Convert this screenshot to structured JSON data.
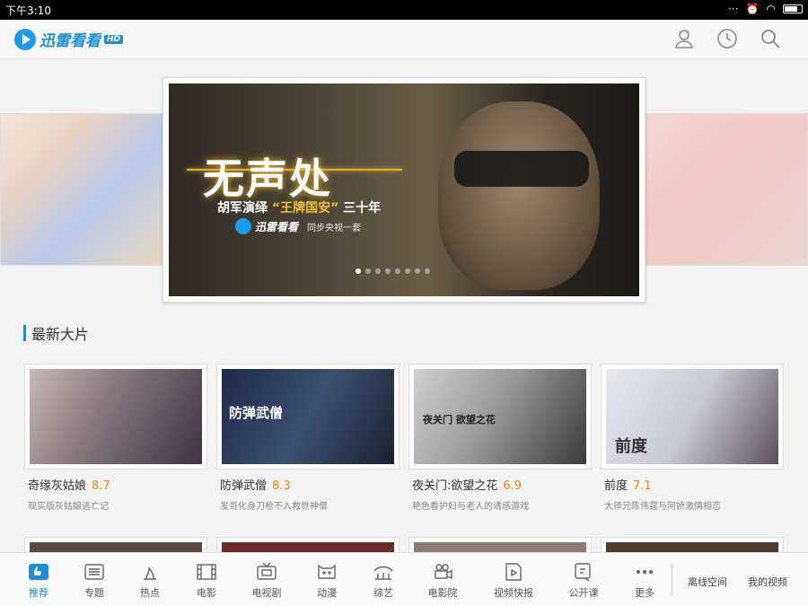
{
  "status_bar": {
    "time": "下午3:10"
  },
  "header": {
    "logo_text": "迅雷看看",
    "logo_badge": "HD",
    "icons": [
      "user-icon",
      "history-clock-icon",
      "search-icon"
    ]
  },
  "banner": {
    "title": "无声处",
    "subtitle_prefix": "胡军演绎",
    "subtitle_highlight": "“王牌国安”",
    "subtitle_suffix": "三十年",
    "brand_text": "迅雷看看",
    "brand_sub": "同步央视一套",
    "dot_count": 8,
    "active_dot": 0
  },
  "section": {
    "title": "最新大片"
  },
  "movies": [
    {
      "title": "奇缘灰姑娘",
      "score": "8.7",
      "desc": "现实版灰姑娘逃亡记"
    },
    {
      "title": "防弹武僧",
      "score": "8.3",
      "desc": "发哥化身刀枪不入救世神僧",
      "thumb_text": "防弹武僧"
    },
    {
      "title": "夜关门:欲望之花",
      "score": "6.9",
      "desc": "艳色看护妇与老人的诱惑游戏",
      "thumb_text": "夜关门 欲望之花"
    },
    {
      "title": "前度",
      "score": "7.1",
      "desc": "大师兄陈伟霆与阿娇激情相恋",
      "thumb_text": "前度"
    }
  ],
  "bottom_nav": {
    "items": [
      {
        "label": "推荐",
        "icon": "thumbs-up-icon",
        "active": true
      },
      {
        "label": "专题",
        "icon": "list-icon"
      },
      {
        "label": "热点",
        "icon": "fire-icon"
      },
      {
        "label": "电影",
        "icon": "film-icon"
      },
      {
        "label": "电视剧",
        "icon": "tv-icon"
      },
      {
        "label": "动漫",
        "icon": "anime-icon"
      },
      {
        "label": "综艺",
        "icon": "variety-icon"
      },
      {
        "label": "电影院",
        "icon": "camera-icon"
      },
      {
        "label": "视频快报",
        "icon": "video-news-icon"
      },
      {
        "label": "公开课",
        "icon": "open-course-icon"
      },
      {
        "label": "更多",
        "icon": "more-icon"
      }
    ],
    "offline_label": "离线空间",
    "my_videos_label": "我的视频"
  },
  "colors": {
    "accent": "#1c8fd6",
    "score": "#f08a00"
  }
}
